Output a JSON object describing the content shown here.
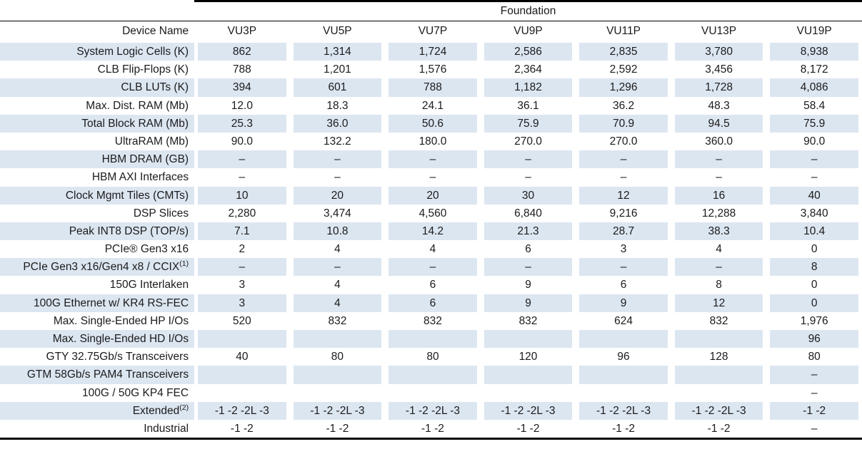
{
  "table": {
    "group_header": "Foundation",
    "row_header_label": "Device Name",
    "columns": [
      "VU3P",
      "VU5P",
      "VU7P",
      "VU9P",
      "VU11P",
      "VU13P",
      "VU19P"
    ],
    "shade_color": "#dce6f1",
    "rule_color": "#000000",
    "rows": [
      {
        "label": "System Logic Cells (K)",
        "label_sup": "",
        "values": [
          "862",
          "1,314",
          "1,724",
          "2,586",
          "2,835",
          "3,780",
          "8,938"
        ]
      },
      {
        "label": "CLB Flip-Flops (K)",
        "label_sup": "",
        "values": [
          "788",
          "1,201",
          "1,576",
          "2,364",
          "2,592",
          "3,456",
          "8,172"
        ]
      },
      {
        "label": "CLB LUTs (K)",
        "label_sup": "",
        "values": [
          "394",
          "601",
          "788",
          "1,182",
          "1,296",
          "1,728",
          "4,086"
        ]
      },
      {
        "label": "Max. Dist. RAM (Mb)",
        "label_sup": "",
        "values": [
          "12.0",
          "18.3",
          "24.1",
          "36.1",
          "36.2",
          "48.3",
          "58.4"
        ]
      },
      {
        "label": "Total Block RAM (Mb)",
        "label_sup": "",
        "values": [
          "25.3",
          "36.0",
          "50.6",
          "75.9",
          "70.9",
          "94.5",
          "75.9"
        ]
      },
      {
        "label": "UltraRAM (Mb)",
        "label_sup": "",
        "values": [
          "90.0",
          "132.2",
          "180.0",
          "270.0",
          "270.0",
          "360.0",
          "90.0"
        ]
      },
      {
        "label": "HBM DRAM (GB)",
        "label_sup": "",
        "values": [
          "–",
          "–",
          "–",
          "–",
          "–",
          "–",
          "–"
        ]
      },
      {
        "label": "HBM AXI Interfaces",
        "label_sup": "",
        "values": [
          "–",
          "–",
          "–",
          "–",
          "–",
          "–",
          "–"
        ]
      },
      {
        "label": "Clock Mgmt Tiles (CMTs)",
        "label_sup": "",
        "values": [
          "10",
          "20",
          "20",
          "30",
          "12",
          "16",
          "40"
        ]
      },
      {
        "label": "DSP Slices",
        "label_sup": "",
        "values": [
          "2,280",
          "3,474",
          "4,560",
          "6,840",
          "9,216",
          "12,288",
          "3,840"
        ]
      },
      {
        "label": "Peak INT8 DSP (TOP/s)",
        "label_sup": "",
        "values": [
          "7.1",
          "10.8",
          "14.2",
          "21.3",
          "28.7",
          "38.3",
          "10.4"
        ]
      },
      {
        "label": "PCIe® Gen3 x16",
        "label_sup": "",
        "values": [
          "2",
          "4",
          "4",
          "6",
          "3",
          "4",
          "0"
        ]
      },
      {
        "label": "PCIe Gen3 x16/Gen4 x8 / CCIX",
        "label_sup": "(1)",
        "values": [
          "–",
          "–",
          "–",
          "–",
          "–",
          "–",
          "8"
        ]
      },
      {
        "label": "150G Interlaken",
        "label_sup": "",
        "values": [
          "3",
          "4",
          "6",
          "9",
          "6",
          "8",
          "0"
        ]
      },
      {
        "label": "100G Ethernet w/ KR4 RS-FEC",
        "label_sup": "",
        "values": [
          "3",
          "4",
          "6",
          "9",
          "9",
          "12",
          "0"
        ]
      },
      {
        "label": "Max. Single-Ended HP I/Os",
        "label_sup": "",
        "values": [
          "520",
          "832",
          "832",
          "832",
          "624",
          "832",
          "1,976"
        ]
      },
      {
        "label": "Max. Single-Ended HD I/Os",
        "label_sup": "",
        "values": [
          "",
          "",
          "",
          "",
          "",
          "",
          "96"
        ]
      },
      {
        "label": "GTY 32.75Gb/s Transceivers",
        "label_sup": "",
        "values": [
          "40",
          "80",
          "80",
          "120",
          "96",
          "128",
          "80"
        ]
      },
      {
        "label": "GTM 58Gb/s PAM4 Transceivers",
        "label_sup": "",
        "values": [
          "",
          "",
          "",
          "",
          "",
          "",
          "–"
        ]
      },
      {
        "label": "100G / 50G KP4 FEC",
        "label_sup": "",
        "values": [
          "",
          "",
          "",
          "",
          "",
          "",
          "–"
        ]
      },
      {
        "label": "Extended",
        "label_sup": "(2)",
        "values": [
          "-1 -2 -2L -3",
          "-1 -2 -2L -3",
          "-1 -2 -2L -3",
          "-1 -2 -2L -3",
          "-1 -2 -2L -3",
          "-1 -2 -2L -3",
          "-1 -2"
        ]
      },
      {
        "label": "Industrial",
        "label_sup": "",
        "values": [
          "-1 -2",
          "-1 -2",
          "-1 -2",
          "-1 -2",
          "-1 -2",
          "-1 -2",
          "–"
        ]
      }
    ]
  }
}
